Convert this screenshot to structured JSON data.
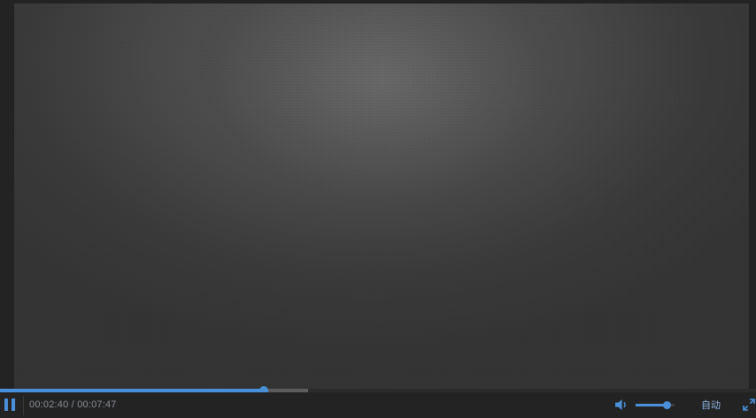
{
  "player": {
    "state": "playing",
    "current_time": "00:02:40",
    "separator": " / ",
    "duration": "00:07:47",
    "progress_fraction": 0.349,
    "buffered_fraction": 0.408,
    "volume_fraction": 0.8,
    "quality_label": "自动"
  },
  "icons": {
    "pause": "pause-icon",
    "volume": "volume-icon",
    "fullscreen": "fullscreen-icon"
  },
  "colors": {
    "accent": "#4a90d9",
    "background": "#232323",
    "time_text": "#8a8f96",
    "quality_text": "#8fb8e6"
  }
}
